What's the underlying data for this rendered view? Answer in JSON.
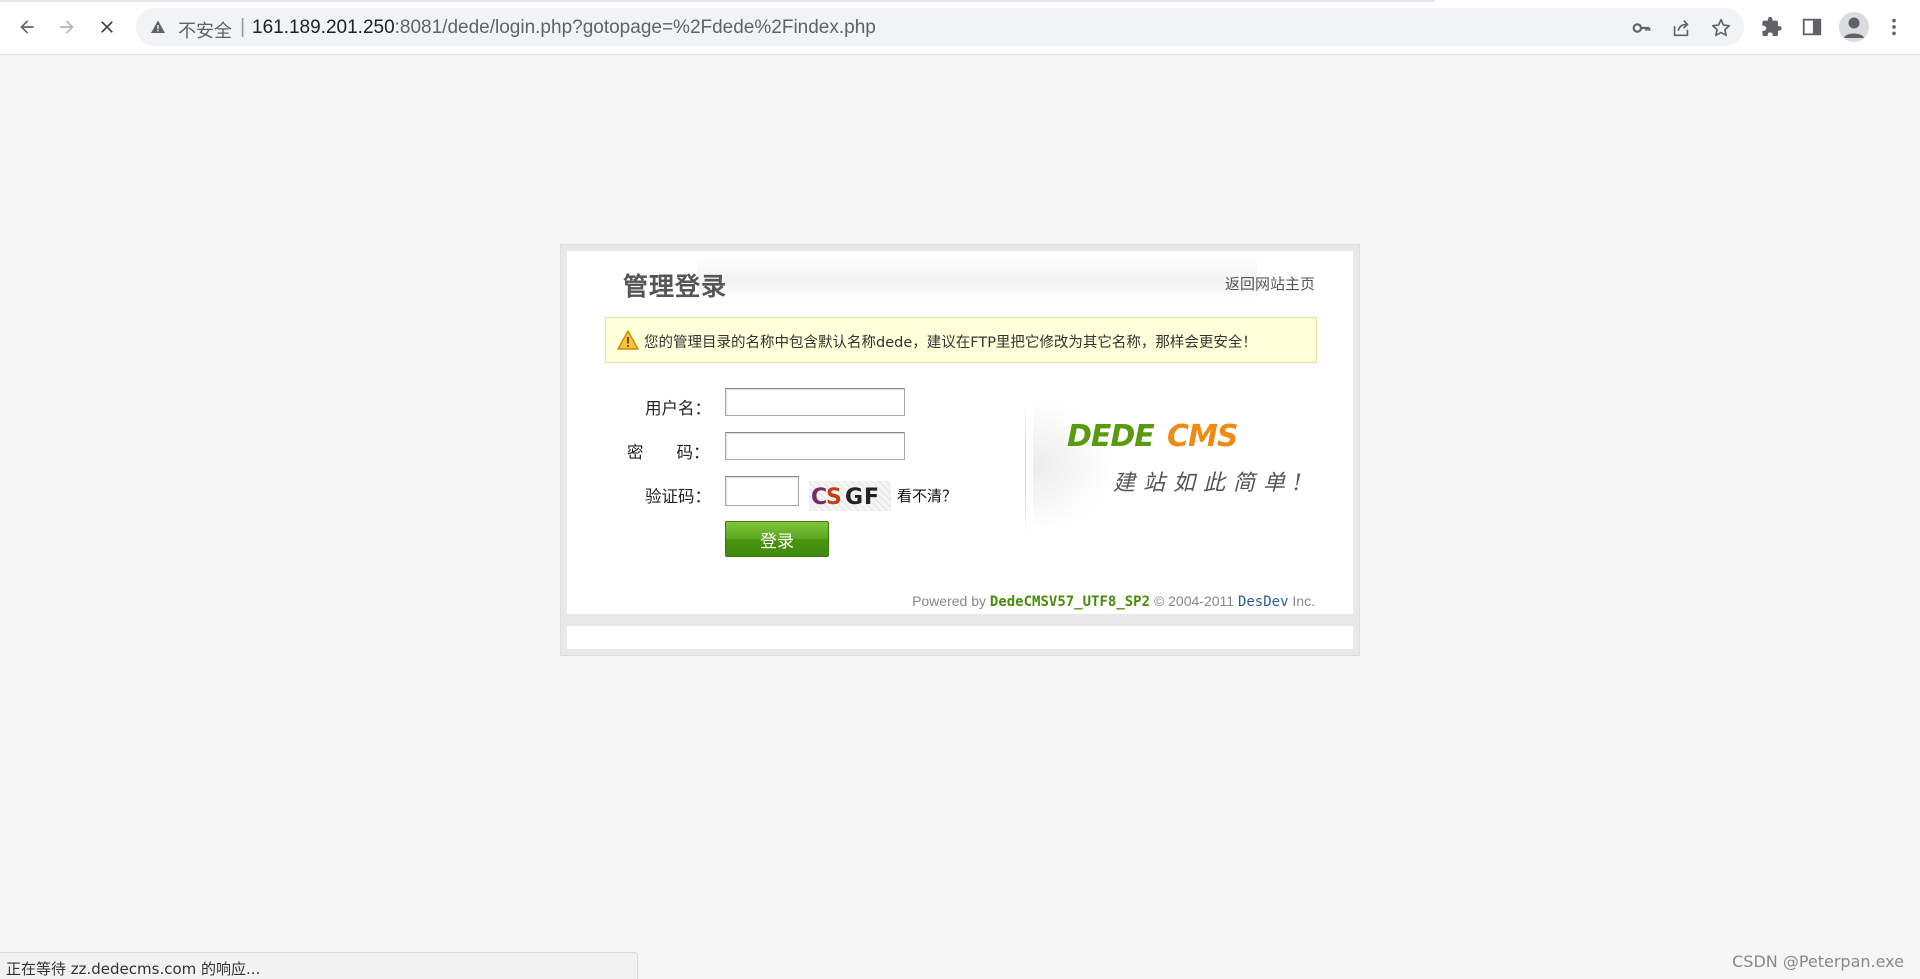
{
  "browser": {
    "security_label": "不安全",
    "separator": "|",
    "url_host": "161.189.201.250",
    "url_rest": ":8081/dede/login.php?gotopage=%2Fdede%2Findex.php",
    "icons": [
      "back-icon",
      "forward-icon",
      "stop-icon",
      "warning-icon",
      "key-icon",
      "share-icon",
      "star-icon",
      "extensions-icon",
      "side-panel-icon",
      "profile-icon",
      "menu-icon"
    ]
  },
  "login": {
    "title": "管理登录",
    "home_link": "返回网站主页",
    "notice": "您的管理目录的名称中包含默认名称dede，建议在FTP里把它修改为其它名称，那样会更安全！",
    "username_label": "用户名：",
    "password_label": "密　　码：",
    "captcha_label": "验证码：",
    "username_value": "",
    "password_value": "",
    "captcha_value": "",
    "captcha_text": "CSGF",
    "refresh_link": "看不清？",
    "login_button": "登录",
    "logo_text": "DEDECMS",
    "slogan": "建站如此简单!",
    "powered_prefix": "Powered by",
    "version": "DedeCMSV57_UTF8_SP2",
    "copyright": "© 2004-2011",
    "dev_name": "DesDev",
    "inc": "Inc."
  },
  "status": {
    "text": "正在等待 zz.dedecms.com 的响应..."
  },
  "watermark": "CSDN @Peterpan.exe",
  "colors": {
    "page_bg": "#f6f6f6",
    "button_green": "#4a9512",
    "logo_green": "#5a9a10",
    "logo_orange": "#f08a10",
    "notice_bg": "#ffffd9"
  }
}
